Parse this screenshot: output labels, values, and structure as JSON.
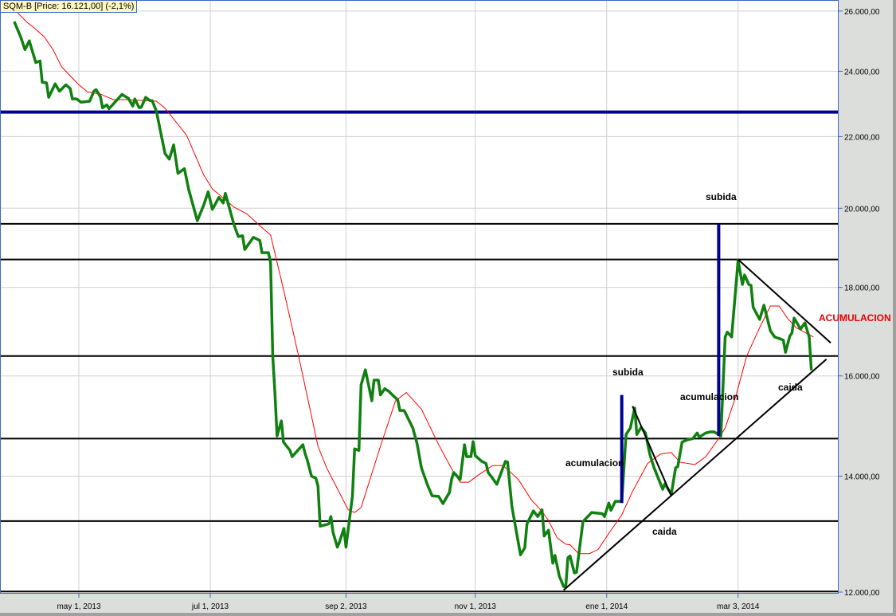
{
  "header": {
    "title": "SQM-B [Price: 16.121,00] (-2,1%)"
  },
  "annotations": {
    "subida_top": "subida",
    "subida_mid": "subida",
    "acumulacion_left": "acumulacion",
    "acumulacion_right": "acumulacion",
    "caida_bottom": "caida",
    "caida_right": "caida",
    "acumulacion_red": "ACUMULACION"
  },
  "colors": {
    "price": "#108010",
    "ma": "#ff0000",
    "navy": "#000090",
    "trend": "#000000",
    "grid": "#d0d0d0",
    "axis_bg": "#dcdedc",
    "border": "#3a66c8"
  },
  "chart_data": {
    "type": "line",
    "title": "SQM-B",
    "x_unit": "days since 2013-05-01",
    "y_scale": "log",
    "ylim": [
      12000,
      26300
    ],
    "xlim": [
      -37,
      352
    ],
    "grid": true,
    "y_ticks": [
      {
        "value": 12000,
        "label": "12.000,00"
      },
      {
        "value": 14000,
        "label": "14.000,00"
      },
      {
        "value": 16000,
        "label": "16.000,00"
      },
      {
        "value": 18000,
        "label": "18.000,00"
      },
      {
        "value": 20000,
        "label": "20.000,00"
      },
      {
        "value": 22000,
        "label": "22.000,00"
      },
      {
        "value": 24000,
        "label": "24.000,00"
      },
      {
        "value": 26000,
        "label": "26.000,00"
      }
    ],
    "x_ticks": [
      {
        "value": 0,
        "label": "may 1, 2013"
      },
      {
        "value": 61,
        "label": "jul 1, 2013"
      },
      {
        "value": 124,
        "label": "sep 2, 2013"
      },
      {
        "value": 184,
        "label": "nov 1, 2013"
      },
      {
        "value": 245,
        "label": "ene 1, 2014"
      },
      {
        "value": 306,
        "label": "mar 3, 2014"
      }
    ],
    "series": [
      {
        "name": "Price",
        "points": [
          [
            -30,
            25640
          ],
          [
            -27,
            25120
          ],
          [
            -25,
            24700
          ],
          [
            -23,
            24990
          ],
          [
            -20,
            24280
          ],
          [
            -18,
            24330
          ],
          [
            -17,
            23650
          ],
          [
            -15,
            23630
          ],
          [
            -14,
            23180
          ],
          [
            -11,
            23600
          ],
          [
            -9,
            23370
          ],
          [
            -6,
            23570
          ],
          [
            -4,
            23450
          ],
          [
            -3,
            23130
          ],
          [
            -1,
            23130
          ],
          [
            1,
            23030
          ],
          [
            5,
            23060
          ],
          [
            7,
            23370
          ],
          [
            8,
            23420
          ],
          [
            10,
            23200
          ],
          [
            11,
            22860
          ],
          [
            13,
            22950
          ],
          [
            14,
            22830
          ],
          [
            20,
            23270
          ],
          [
            23,
            23150
          ],
          [
            25,
            22910
          ],
          [
            26,
            23130
          ],
          [
            28,
            22860
          ],
          [
            29,
            22880
          ],
          [
            31,
            23180
          ],
          [
            33,
            23080
          ],
          [
            34,
            23080
          ],
          [
            36,
            22760
          ],
          [
            38,
            22120
          ],
          [
            40,
            21510
          ],
          [
            42,
            21350
          ],
          [
            44,
            21760
          ],
          [
            46,
            20950
          ],
          [
            49,
            21080
          ],
          [
            51,
            20500
          ],
          [
            55,
            19670
          ],
          [
            58,
            20090
          ],
          [
            60,
            20440
          ],
          [
            62,
            19970
          ],
          [
            65,
            20290
          ],
          [
            67,
            20140
          ],
          [
            68,
            20400
          ],
          [
            72,
            19570
          ],
          [
            74,
            19260
          ],
          [
            76,
            19280
          ],
          [
            77,
            18930
          ],
          [
            81,
            19240
          ],
          [
            84,
            19160
          ],
          [
            85,
            18850
          ],
          [
            88,
            18850
          ],
          [
            89,
            18600
          ],
          [
            90,
            16430
          ],
          [
            91,
            15650
          ],
          [
            92,
            14770
          ],
          [
            94,
            15070
          ],
          [
            95,
            14650
          ],
          [
            98,
            14490
          ],
          [
            99,
            14370
          ],
          [
            104,
            14600
          ],
          [
            105,
            14430
          ],
          [
            106,
            14310
          ],
          [
            108,
            14000
          ],
          [
            110,
            13965
          ],
          [
            111,
            13820
          ],
          [
            112,
            13100
          ],
          [
            116,
            13140
          ],
          [
            117,
            13270
          ],
          [
            118,
            12990
          ],
          [
            120,
            12740
          ],
          [
            121,
            12830
          ],
          [
            123,
            13060
          ],
          [
            124,
            12740
          ],
          [
            127,
            13640
          ],
          [
            128,
            14520
          ],
          [
            130,
            14490
          ],
          [
            131,
            15810
          ],
          [
            133,
            16130
          ],
          [
            136,
            15480
          ],
          [
            137,
            15910
          ],
          [
            139,
            15910
          ],
          [
            140,
            15600
          ],
          [
            142,
            15730
          ],
          [
            144,
            15670
          ],
          [
            146,
            15580
          ],
          [
            148,
            15500
          ],
          [
            149,
            15280
          ],
          [
            151,
            15280
          ],
          [
            155,
            14930
          ],
          [
            157,
            14620
          ],
          [
            159,
            14160
          ],
          [
            162,
            13820
          ],
          [
            164,
            13640
          ],
          [
            167,
            13630
          ],
          [
            169,
            13500
          ],
          [
            172,
            13700
          ],
          [
            173,
            13940
          ],
          [
            174,
            14070
          ],
          [
            177,
            13940
          ],
          [
            179,
            14600
          ],
          [
            180,
            14370
          ],
          [
            182,
            14370
          ],
          [
            183,
            14660
          ],
          [
            184,
            14390
          ],
          [
            187,
            14280
          ],
          [
            189,
            14240
          ],
          [
            190,
            14070
          ],
          [
            192,
            13965
          ],
          [
            194,
            13850
          ],
          [
            198,
            14280
          ],
          [
            199,
            14265
          ],
          [
            201,
            13450
          ],
          [
            205,
            12610
          ],
          [
            207,
            12730
          ],
          [
            208,
            13140
          ],
          [
            211,
            13370
          ],
          [
            213,
            13270
          ],
          [
            215,
            13390
          ],
          [
            216,
            12930
          ],
          [
            218,
            13030
          ],
          [
            220,
            12470
          ],
          [
            221,
            12600
          ],
          [
            223,
            12260
          ],
          [
            225,
            12090
          ],
          [
            226,
            12080
          ],
          [
            227,
            12560
          ],
          [
            228,
            12590
          ],
          [
            230,
            12310
          ],
          [
            231,
            12320
          ],
          [
            234,
            13180
          ],
          [
            238,
            13340
          ],
          [
            243,
            13320
          ],
          [
            244,
            13270
          ],
          [
            246,
            13510
          ],
          [
            247,
            13380
          ],
          [
            249,
            13540
          ],
          [
            252,
            13540
          ],
          [
            254,
            14800
          ],
          [
            256,
            14930
          ],
          [
            258,
            15330
          ],
          [
            259,
            14800
          ],
          [
            261,
            14940
          ],
          [
            263,
            14830
          ],
          [
            265,
            14420
          ],
          [
            267,
            14160
          ],
          [
            271,
            13760
          ],
          [
            272,
            13860
          ],
          [
            275,
            13670
          ],
          [
            277,
            14160
          ],
          [
            278,
            14180
          ],
          [
            280,
            14650
          ],
          [
            282,
            14690
          ],
          [
            285,
            14720
          ],
          [
            287,
            14830
          ],
          [
            288,
            14750
          ],
          [
            291,
            14830
          ],
          [
            293,
            14850
          ],
          [
            295,
            14850
          ],
          [
            298,
            14770
          ],
          [
            300,
            16850
          ],
          [
            301,
            16960
          ],
          [
            303,
            16850
          ],
          [
            306,
            18660
          ],
          [
            308,
            18070
          ],
          [
            309,
            18300
          ],
          [
            311,
            18070
          ],
          [
            312,
            18050
          ],
          [
            313,
            17530
          ],
          [
            316,
            17250
          ],
          [
            318,
            17580
          ],
          [
            321,
            16990
          ],
          [
            323,
            16850
          ],
          [
            326,
            16800
          ],
          [
            327,
            16780
          ],
          [
            328,
            16510
          ],
          [
            330,
            16870
          ],
          [
            331,
            16940
          ],
          [
            332,
            17280
          ],
          [
            335,
            17030
          ],
          [
            337,
            17170
          ],
          [
            339,
            16850
          ],
          [
            340,
            16121
          ]
        ]
      },
      {
        "name": "Moving average",
        "points": [
          [
            -30,
            26060
          ],
          [
            -24,
            25610
          ],
          [
            -21,
            25440
          ],
          [
            -16,
            25120
          ],
          [
            -12,
            24700
          ],
          [
            -8,
            24140
          ],
          [
            -4,
            23850
          ],
          [
            0,
            23570
          ],
          [
            4,
            23350
          ],
          [
            10,
            23280
          ],
          [
            16,
            23110
          ],
          [
            21,
            23110
          ],
          [
            36,
            23060
          ],
          [
            40,
            22850
          ],
          [
            50,
            22040
          ],
          [
            58,
            20900
          ],
          [
            62,
            20520
          ],
          [
            72,
            20030
          ],
          [
            78,
            19850
          ],
          [
            84,
            19540
          ],
          [
            89,
            19300
          ],
          [
            95,
            17950
          ],
          [
            102,
            16430
          ],
          [
            111,
            14570
          ],
          [
            115,
            14160
          ],
          [
            120,
            13770
          ],
          [
            125,
            13390
          ],
          [
            128,
            13340
          ],
          [
            131,
            13430
          ],
          [
            140,
            14570
          ],
          [
            147,
            15480
          ],
          [
            152,
            15650
          ],
          [
            159,
            15310
          ],
          [
            167,
            14600
          ],
          [
            174,
            14070
          ],
          [
            177,
            13890
          ],
          [
            181,
            13890
          ],
          [
            185,
            14010
          ],
          [
            192,
            14200
          ],
          [
            197,
            14200
          ],
          [
            204,
            13940
          ],
          [
            210,
            13570
          ],
          [
            215,
            13360
          ],
          [
            218,
            13200
          ],
          [
            222,
            12900
          ],
          [
            226,
            12790
          ],
          [
            228,
            12780
          ],
          [
            232,
            12630
          ],
          [
            237,
            12630
          ],
          [
            241,
            12700
          ],
          [
            247,
            13030
          ],
          [
            252,
            13300
          ],
          [
            257,
            13720
          ],
          [
            264,
            14240
          ],
          [
            270,
            14420
          ],
          [
            275,
            14450
          ],
          [
            279,
            14265
          ],
          [
            286,
            14220
          ],
          [
            291,
            14370
          ],
          [
            297,
            14720
          ],
          [
            300,
            14930
          ],
          [
            305,
            15580
          ],
          [
            310,
            16430
          ],
          [
            316,
            17060
          ],
          [
            321,
            17560
          ],
          [
            325,
            17560
          ],
          [
            329,
            17270
          ],
          [
            333,
            17060
          ],
          [
            341,
            16850
          ]
        ]
      }
    ],
    "horizontal_levels": [
      {
        "price": 22730,
        "style": "navy"
      },
      {
        "price": 19590,
        "style": "black"
      },
      {
        "price": 18680,
        "style": "black"
      },
      {
        "price": 16430,
        "style": "black"
      },
      {
        "price": 14720,
        "style": "black"
      },
      {
        "price": 13190,
        "style": "black"
      },
      {
        "price": 12010,
        "style": "black"
      }
    ],
    "vertical_moves": [
      {
        "day": 252,
        "from": 13510,
        "to": 15600
      },
      {
        "day": 297,
        "from": 14770,
        "to": 19590
      }
    ],
    "trend_lines": [
      {
        "from": [
          225,
          12030
        ],
        "to": [
          347,
          16360
        ]
      },
      {
        "from": [
          306,
          18680
        ],
        "to": [
          349,
          16720
        ]
      },
      {
        "from": [
          257,
          15370
        ],
        "to": [
          275,
          13640
        ]
      }
    ]
  }
}
